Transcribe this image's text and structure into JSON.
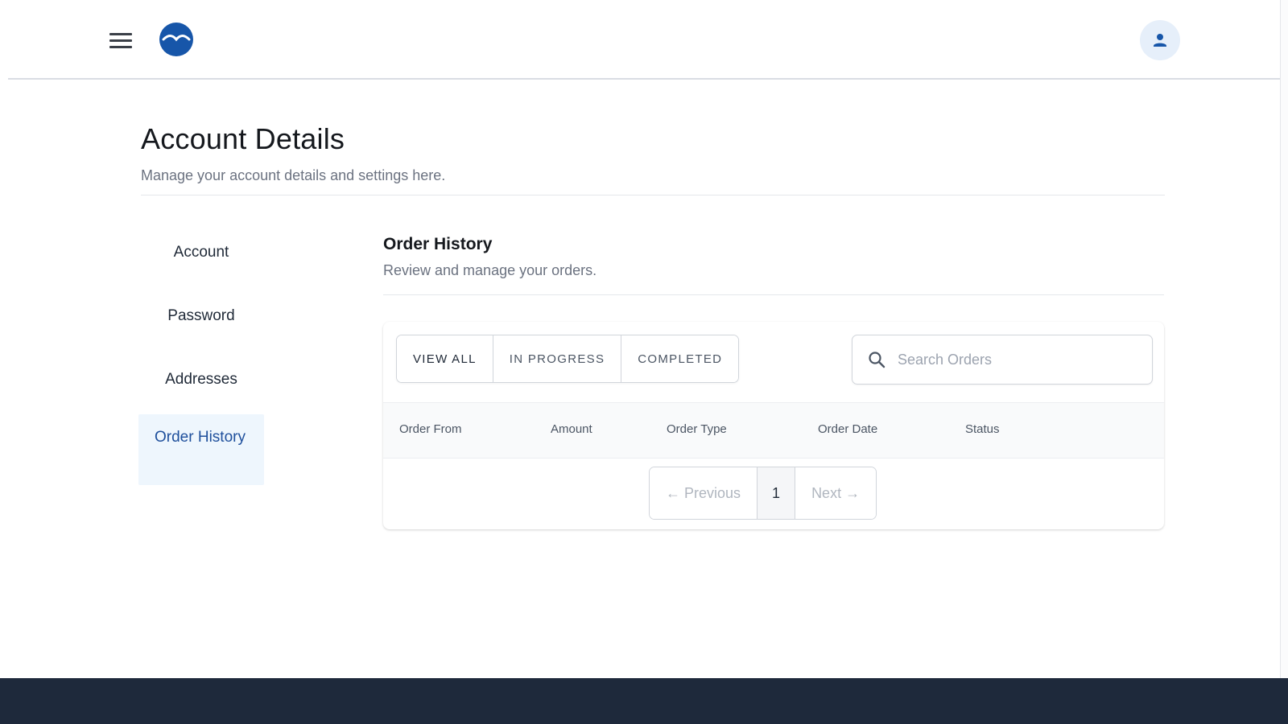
{
  "header": {
    "menu_icon": "hamburger-icon",
    "logo_icon": "brand-logo",
    "profile_icon": "user-icon",
    "accent_color": "#1756a9"
  },
  "page": {
    "title": "Account Details",
    "subtitle": "Manage your account details and settings here."
  },
  "sidebar": {
    "items": [
      {
        "label": "Account",
        "active": false
      },
      {
        "label": "Password",
        "active": false
      },
      {
        "label": "Addresses",
        "active": false
      },
      {
        "label": "Order History",
        "active": true
      }
    ]
  },
  "orders": {
    "title": "Order History",
    "subtitle": "Review and manage your orders.",
    "filters": [
      {
        "label": "VIEW ALL",
        "active": true
      },
      {
        "label": "IN PROGRESS",
        "active": false
      },
      {
        "label": "COMPLETED",
        "active": false
      }
    ],
    "search": {
      "placeholder": "Search Orders",
      "value": "",
      "icon": "search-icon"
    },
    "columns": [
      "Order From",
      "Amount",
      "Order Type",
      "Order Date",
      "Status"
    ],
    "rows": [],
    "pagination": {
      "previous": "← Previous",
      "current": "1",
      "next": "Next →"
    }
  },
  "footer": {
    "color": "#1e293b"
  }
}
